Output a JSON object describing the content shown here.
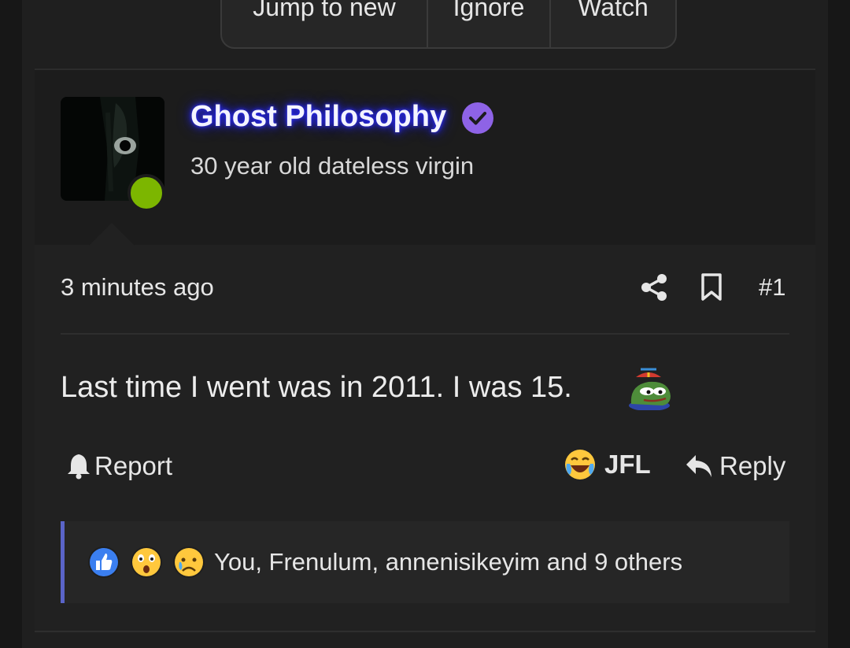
{
  "top_actions": {
    "jump": "Jump to new",
    "ignore": "Ignore",
    "watch": "Watch"
  },
  "post": {
    "username": "Ghost Philosophy",
    "user_title": "30 year old dateless virgin",
    "time": "3 minutes ago",
    "number": "#1",
    "text": "Last time I went was in 2011. I was 15.",
    "actions": {
      "report": "Report",
      "jfl": "JFL",
      "reply": "Reply"
    },
    "reactions_text": "You, Frenulum, annenisikeyim and 9 others",
    "icons": [
      "share-icon",
      "bookmark-icon",
      "bell-icon",
      "reply-icon",
      "verified-icon"
    ]
  },
  "colors": {
    "accent": "#5a64c8",
    "online": "#7cb600",
    "verified": "#8e63e6"
  }
}
